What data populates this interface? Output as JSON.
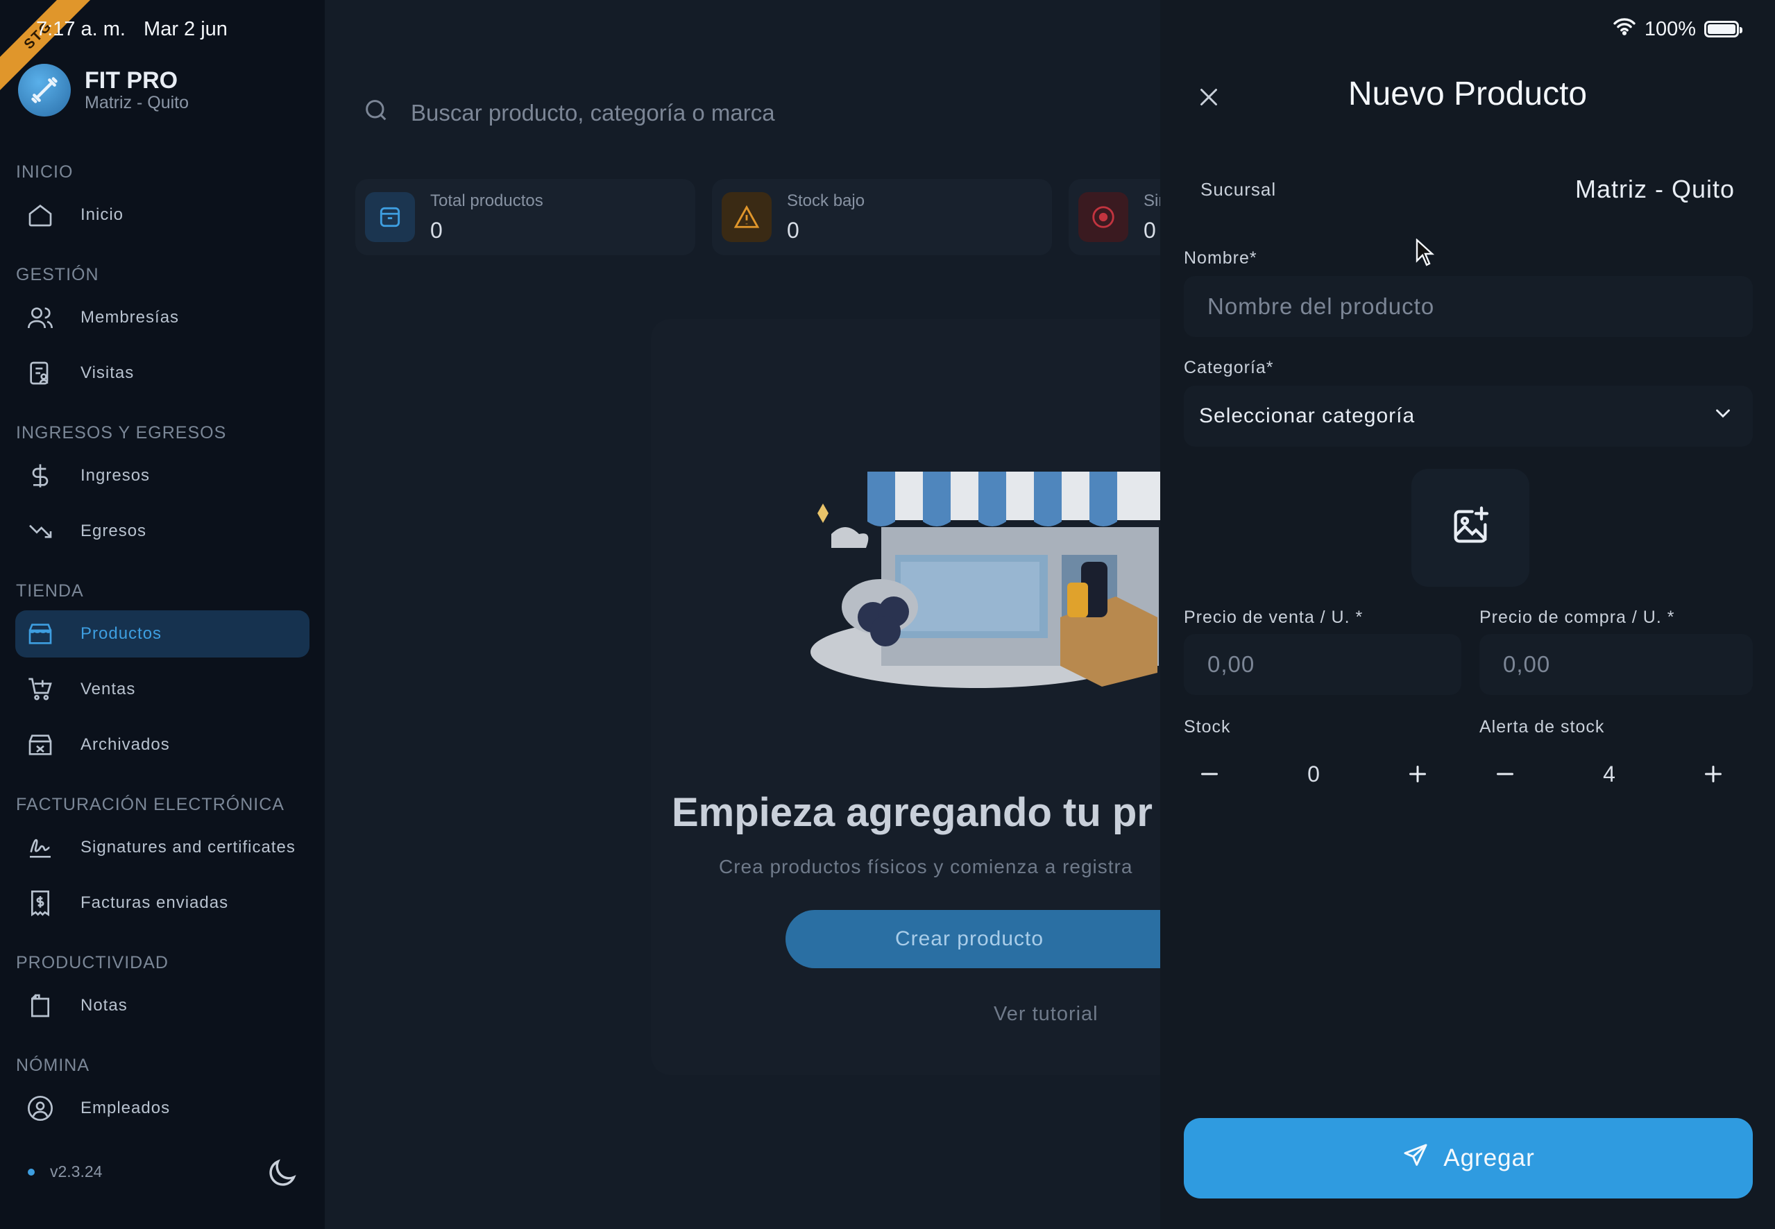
{
  "status_bar": {
    "time": "7:17 a. m.",
    "date": "Mar 2 jun",
    "battery": "100%",
    "ribbon": "STG"
  },
  "brand": {
    "name": "FIT PRO",
    "branch": "Matriz - Quito"
  },
  "sidebar": {
    "sections": {
      "inicio": "INICIO",
      "gestion": "GESTIÓN",
      "ingresos_egresos": "INGRESOS Y EGRESOS",
      "tienda": "TIENDA",
      "facturacion": "FACTURACIÓN ELECTRÓNICA",
      "productividad": "PRODUCTIVIDAD",
      "nomina": "NÓMINA"
    },
    "items": {
      "inicio": "Inicio",
      "membresias": "Membresías",
      "visitas": "Visitas",
      "ingresos": "Ingresos",
      "egresos": "Egresos",
      "productos": "Productos",
      "ventas": "Ventas",
      "archivados": "Archivados",
      "signatures": "Signatures and certificates",
      "facturas": "Facturas enviadas",
      "notas": "Notas",
      "empleados": "Empleados"
    },
    "version": "v2.3.24",
    "active_item": "Productos"
  },
  "main": {
    "search_placeholder": "Buscar producto, categoría o marca",
    "stats": [
      {
        "label": "Total productos",
        "value": "0"
      },
      {
        "label": "Stock bajo",
        "value": "0"
      },
      {
        "label": "Sin",
        "value": "0"
      }
    ],
    "empty_title": "Empieza agregando tu pr",
    "empty_subtitle": "Crea productos físicos y comienza a registra",
    "create_button": "Crear producto",
    "tutorial_link": "Ver tutorial"
  },
  "panel": {
    "title": "Nuevo Producto",
    "branch_label": "Sucursal",
    "branch_value": "Matriz - Quito",
    "name_label": "Nombre*",
    "name_placeholder": "Nombre del producto",
    "category_label": "Categoría*",
    "category_value": "Seleccionar categoría",
    "sale_price_label": "Precio de venta / U. *",
    "sale_price_placeholder": "0,00",
    "cost_price_label": "Precio de compra / U. *",
    "cost_price_placeholder": "0,00",
    "stock_label": "Stock",
    "stock_value": "0",
    "stock_alert_label": "Alerta de stock",
    "stock_alert_value": "4",
    "submit_label": "Agregar"
  },
  "colors": {
    "accent": "#2f9be0",
    "active_bg": "#16324f",
    "panel_bg": "#121922",
    "warning": "#e0962b",
    "danger": "#c2343f"
  }
}
